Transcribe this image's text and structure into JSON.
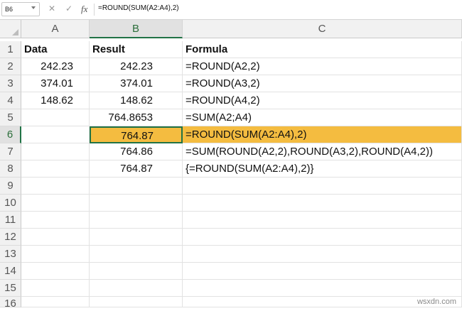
{
  "formula_bar": {
    "name_box": "B6",
    "cancel_icon": "✕",
    "confirm_icon": "✓",
    "fx_label": "fx",
    "formula": "=ROUND(SUM(A2:A4),2)"
  },
  "columns": [
    "A",
    "B",
    "C"
  ],
  "rows": [
    {
      "num": "1",
      "a": "Data",
      "b": "Result",
      "c": "Formula"
    },
    {
      "num": "2",
      "a": "242.23",
      "b": "242.23",
      "c": "=ROUND(A2,2)"
    },
    {
      "num": "3",
      "a": "374.01",
      "b": "374.01",
      "c": "=ROUND(A3,2)"
    },
    {
      "num": "4",
      "a": "148.62",
      "b": "148.62",
      "c": "=ROUND(A4,2)"
    },
    {
      "num": "5",
      "a": "",
      "b": "764.8653",
      "c": "=SUM(A2;A4)"
    },
    {
      "num": "6",
      "a": "",
      "b": "764.87",
      "c": "=ROUND(SUM(A2:A4),2)"
    },
    {
      "num": "7",
      "a": "",
      "b": "764.86",
      "c": "=SUM(ROUND(A2,2),ROUND(A3,2),ROUND(A4,2))"
    },
    {
      "num": "8",
      "a": "",
      "b": "764.87",
      "c": "{=ROUND(SUM(A2:A4),2)}"
    },
    {
      "num": "9",
      "a": "",
      "b": "",
      "c": ""
    },
    {
      "num": "10",
      "a": "",
      "b": "",
      "c": ""
    },
    {
      "num": "11",
      "a": "",
      "b": "",
      "c": ""
    },
    {
      "num": "12",
      "a": "",
      "b": "",
      "c": ""
    },
    {
      "num": "13",
      "a": "",
      "b": "",
      "c": ""
    },
    {
      "num": "14",
      "a": "",
      "b": "",
      "c": ""
    },
    {
      "num": "15",
      "a": "",
      "b": "",
      "c": ""
    },
    {
      "num": "16",
      "a": "",
      "b": "",
      "c": ""
    }
  ],
  "selection": {
    "row": "6",
    "column": "B"
  },
  "colors": {
    "highlight": "#f4bc40",
    "selection_border": "#217346"
  },
  "watermark": "wsxdn.com"
}
